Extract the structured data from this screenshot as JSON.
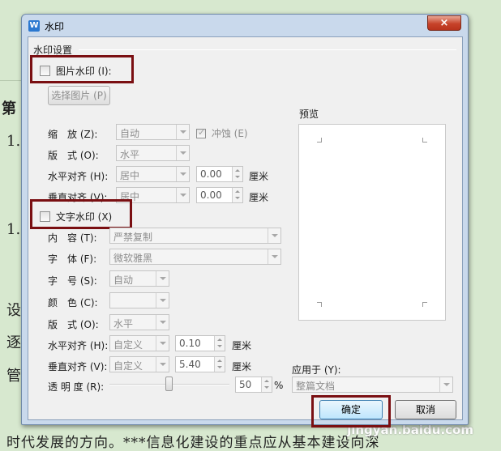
{
  "background_doc": {
    "left_chars": [
      "第",
      "1.",
      "1.",
      "设",
      "逐",
      "管"
    ],
    "bottom_line": "时代发展的方向。***信息化建设的重点应从基本建设向深",
    "site_watermark": "jingyan.baidu.com"
  },
  "dialog": {
    "app_icon": "W",
    "title": "水印",
    "close_label": "×",
    "section_title": "水印设置",
    "picture": {
      "checkbox_label": "图片水印 (I):",
      "select_button": "选择图片 (P)",
      "scale_label": "缩　放 (Z):",
      "scale_value": "自动",
      "washout_label": "冲蚀 (E)",
      "layout_label": "版　式 (O):",
      "layout_value": "水平",
      "halign_label": "水平对齐 (H):",
      "halign_value": "居中",
      "halign_offset": "0.00",
      "valign_label": "垂直对齐 (V):",
      "valign_value": "居中",
      "valign_offset": "0.00",
      "unit": "厘米"
    },
    "text": {
      "checkbox_label": "文字水印 (X)",
      "content_label": "内　容 (T):",
      "content_value": "严禁复制",
      "font_label": "字　体 (F):",
      "font_value": "微软雅黑",
      "size_label": "字　号 (S):",
      "size_value": "自动",
      "color_label": "颜　色 (C):",
      "layout_label": "版　式 (O):",
      "layout_value": "水平",
      "halign_label": "水平对齐 (H):",
      "halign_value": "自定义",
      "halign_offset": "0.10",
      "valign_label": "垂直对齐 (V):",
      "valign_value": "自定义",
      "valign_offset": "5.40",
      "unit": "厘米",
      "transparency_label": "透 明 度 (R):",
      "transparency_value": "50",
      "percent": "%"
    },
    "preview_label": "预览",
    "apply_label": "应用于 (Y):",
    "apply_value": "整篇文档",
    "ok_label": "确定",
    "cancel_label": "取消",
    "colors": {
      "accent_highlight": "#7a0f12",
      "title_bg": "#c9d9ec",
      "close_red": "#c7432a"
    }
  }
}
